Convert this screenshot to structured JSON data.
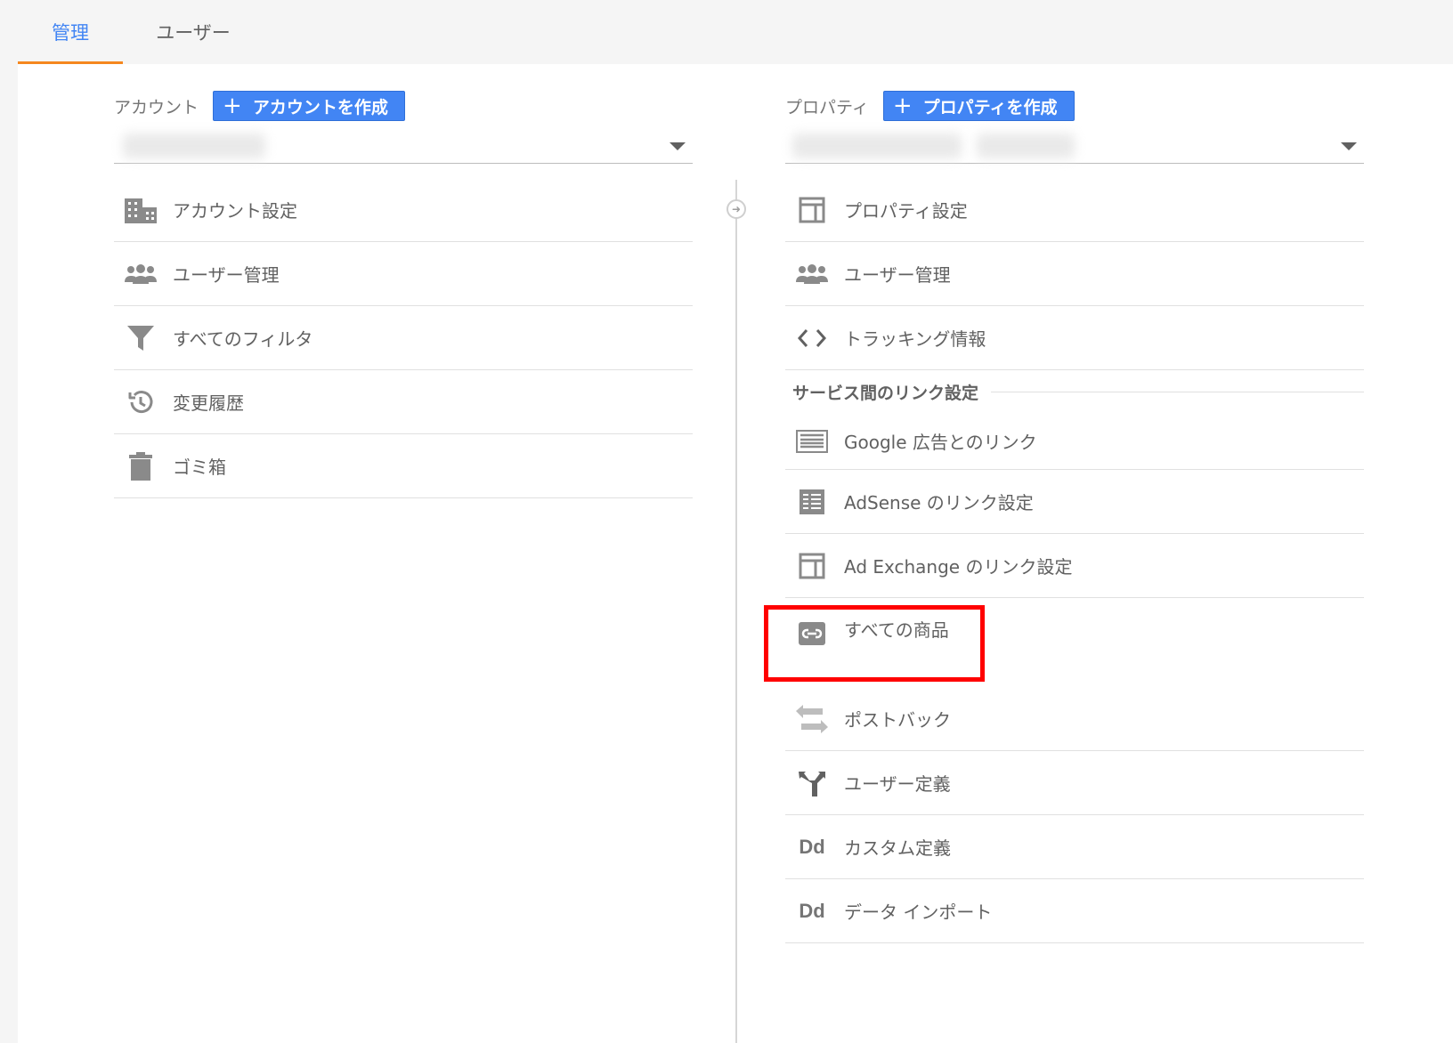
{
  "tabs": [
    {
      "label": "管理",
      "active": true
    },
    {
      "label": "ユーザー",
      "active": false
    }
  ],
  "account": {
    "label": "アカウント",
    "create_button": "アカウントを作成",
    "items": [
      {
        "label": "アカウント設定",
        "icon": "building-icon"
      },
      {
        "label": "ユーザー管理",
        "icon": "people-icon"
      },
      {
        "label": "すべてのフィルタ",
        "icon": "filter-icon"
      },
      {
        "label": "変更履歴",
        "icon": "history-icon"
      },
      {
        "label": "ゴミ箱",
        "icon": "trash-icon"
      }
    ]
  },
  "property": {
    "label": "プロパティ",
    "create_button": "プロパティを作成",
    "items": [
      {
        "label": "プロパティ設定",
        "icon": "property-layout-icon"
      },
      {
        "label": "ユーザー管理",
        "icon": "people-icon"
      },
      {
        "label": "トラッキング情報",
        "icon": "code-icon"
      }
    ],
    "section_title": "サービス間のリンク設定",
    "link_items": [
      {
        "label": "Google 広告とのリンク",
        "icon": "ads-icon"
      },
      {
        "label": "AdSense のリンク設定",
        "icon": "adsense-icon"
      },
      {
        "label": "Ad Exchange のリンク設定",
        "icon": "adexchange-icon"
      },
      {
        "label": "すべての商品",
        "icon": "link-icon"
      },
      {
        "label": "ポストバック",
        "icon": "postback-icon"
      },
      {
        "label": "ユーザー定義",
        "icon": "fork-icon"
      },
      {
        "label": "カスタム定義",
        "icon": "dd-icon"
      },
      {
        "label": "データ インポート",
        "icon": "dd-icon"
      }
    ]
  },
  "icons": {
    "dd_text": "Dd"
  },
  "colors": {
    "accent": "#4285f4",
    "tab_indicator": "#f5871f",
    "highlight": "#ff0000",
    "icon": "#757575"
  }
}
